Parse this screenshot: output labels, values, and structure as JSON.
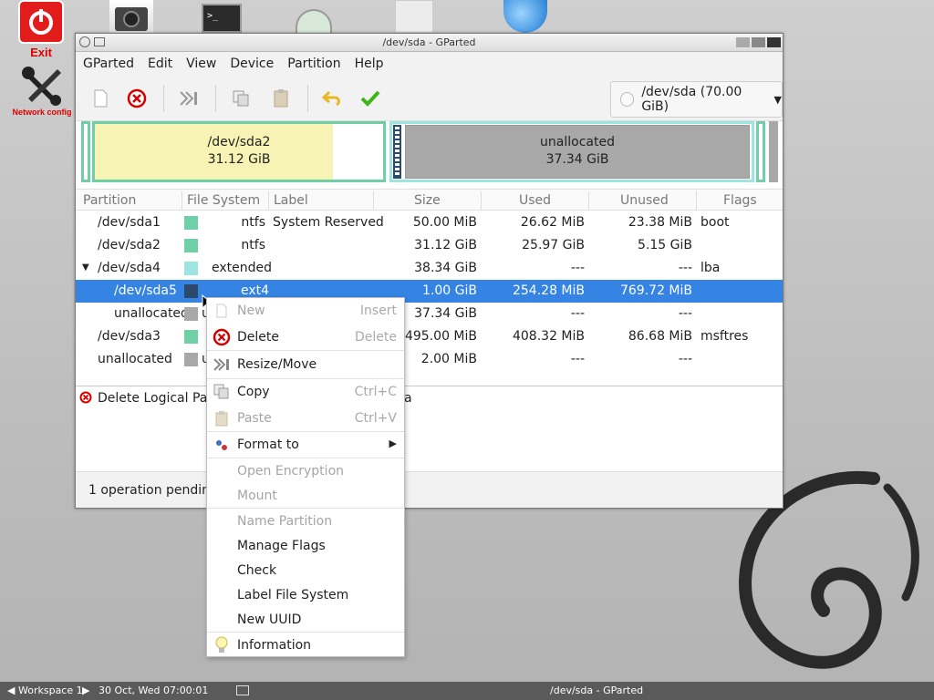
{
  "desktop": {
    "exit_label": "Exit",
    "network_label": "Network config"
  },
  "window": {
    "title": "/dev/sda - GParted",
    "menu": [
      "GParted",
      "Edit",
      "View",
      "Device",
      "Partition",
      "Help"
    ],
    "device_selector": "/dev/sda (70.00 GiB)"
  },
  "diskmap": {
    "seg1_name": "/dev/sda2",
    "seg1_size": "31.12 GiB",
    "seg2_name": "unallocated",
    "seg2_size": "37.34 GiB"
  },
  "columns": [
    "Partition",
    "File System",
    "Label",
    "Size",
    "Used",
    "Unused",
    "Flags"
  ],
  "rows": [
    {
      "partition": "/dev/sda1",
      "fs": "ntfs",
      "label": "System Reserved",
      "size": "50.00 MiB",
      "used": "26.62 MiB",
      "unused": "23.38 MiB",
      "flags": "boot",
      "color": "#6fd0a7"
    },
    {
      "partition": "/dev/sda2",
      "fs": "ntfs",
      "label": "",
      "size": "31.12 GiB",
      "used": "25.97 GiB",
      "unused": "5.15 GiB",
      "flags": "",
      "color": "#6fd0a7"
    },
    {
      "partition": "/dev/sda4",
      "fs": "extended",
      "label": "",
      "size": "38.34 GiB",
      "used": "---",
      "unused": "---",
      "flags": "lba",
      "color": "#9ee4e0"
    },
    {
      "partition": "/dev/sda5",
      "fs": "ext4",
      "label": "",
      "size": "1.00 GiB",
      "used": "254.28 MiB",
      "unused": "769.72 MiB",
      "flags": "",
      "color": "#2b4a6b"
    },
    {
      "partition": "unallocated",
      "fs": "u",
      "label": "",
      "size": "37.34 GiB",
      "used": "---",
      "unused": "---",
      "flags": "",
      "color": "#a8a8a8"
    },
    {
      "partition": "/dev/sda3",
      "fs": "",
      "label": "",
      "size": "495.00 MiB",
      "used": "408.32 MiB",
      "unused": "86.68 MiB",
      "flags": "msftres",
      "color": "#6fd0a7"
    },
    {
      "partition": "unallocated",
      "fs": "u",
      "label": "",
      "size": "2.00 MiB",
      "used": "---",
      "unused": "---",
      "flags": "",
      "color": "#a8a8a8"
    }
  ],
  "operations": {
    "item": "Delete Logical Part",
    "item_tail": "a"
  },
  "status": "1 operation pending",
  "context_menu": {
    "new": "New",
    "new_acc": "Insert",
    "delete": "Delete",
    "delete_acc": "Delete",
    "resize": "Resize/Move",
    "copy": "Copy",
    "copy_acc": "Ctrl+C",
    "paste": "Paste",
    "paste_acc": "Ctrl+V",
    "format": "Format to",
    "open_enc": "Open Encryption",
    "mount": "Mount",
    "name_part": "Name Partition",
    "flags": "Manage Flags",
    "check": "Check",
    "label_fs": "Label File System",
    "new_uuid": "New UUID",
    "info": "Information"
  },
  "taskbar": {
    "workspace": "Workspace 1",
    "datetime": "30 Oct, Wed 07:00:01",
    "task": "/dev/sda - GParted"
  }
}
